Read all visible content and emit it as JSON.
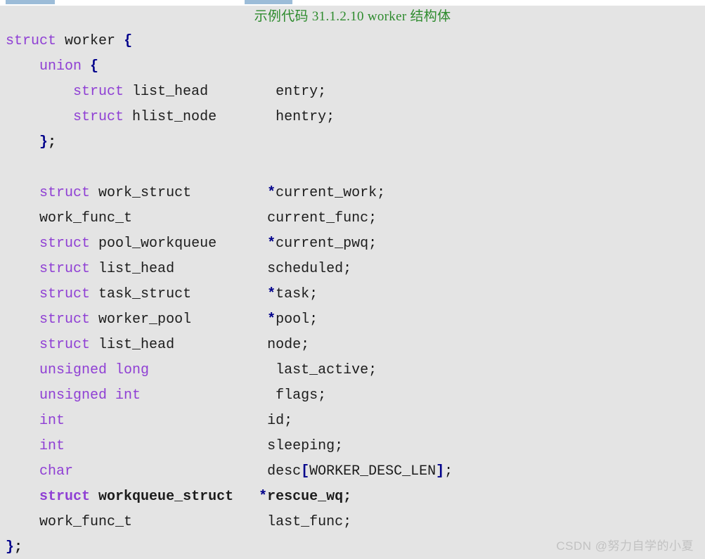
{
  "window": {
    "background_color": "#e4e4e4",
    "accent_color": "#9cbcd8"
  },
  "top_bars": {
    "left_bar_label": "",
    "right_bar_label": ""
  },
  "title": {
    "text": "示例代码 31.1.2.10 worker 结构体",
    "color": "#2e8b2e"
  },
  "watermark": {
    "text": "CSDN @努力自学的小夏",
    "color": "#c2c2c2"
  },
  "code": {
    "language": "c",
    "colors": {
      "keyword": "#8f3fd4",
      "identifier": "#1c1c1c",
      "punctuation": "#00008b",
      "background": "#e4e4e4"
    },
    "lines": [
      {
        "indent": 0,
        "bold": false,
        "tokens": [
          {
            "t": "struct",
            "c": "kw"
          },
          {
            "t": " ",
            "c": "id"
          },
          {
            "t": "worker",
            "c": "id"
          },
          {
            "t": " ",
            "c": "id"
          },
          {
            "t": "{",
            "c": "punct"
          }
        ]
      },
      {
        "indent": 1,
        "bold": false,
        "tokens": [
          {
            "t": "union",
            "c": "kw"
          },
          {
            "t": " ",
            "c": "id"
          },
          {
            "t": "{",
            "c": "punct"
          }
        ]
      },
      {
        "indent": 2,
        "bold": false,
        "tokens": [
          {
            "t": "struct",
            "c": "kw"
          },
          {
            "t": " ",
            "c": "id"
          },
          {
            "t": "list_head",
            "c": "id"
          },
          {
            "t": "        ",
            "c": "id"
          },
          {
            "t": "entry",
            "c": "var"
          },
          {
            "t": ";",
            "c": "semi"
          }
        ]
      },
      {
        "indent": 2,
        "bold": false,
        "tokens": [
          {
            "t": "struct",
            "c": "kw"
          },
          {
            "t": " ",
            "c": "id"
          },
          {
            "t": "hlist_node",
            "c": "id"
          },
          {
            "t": "       ",
            "c": "id"
          },
          {
            "t": "hentry",
            "c": "var"
          },
          {
            "t": ";",
            "c": "semi"
          }
        ]
      },
      {
        "indent": 1,
        "bold": true,
        "tokens": [
          {
            "t": "}",
            "c": "punct"
          },
          {
            "t": ";",
            "c": "semi"
          }
        ]
      },
      {
        "indent": 0,
        "bold": false,
        "blank": true,
        "tokens": []
      },
      {
        "indent": 1,
        "bold": false,
        "tokens": [
          {
            "t": "struct",
            "c": "kw"
          },
          {
            "t": " ",
            "c": "id"
          },
          {
            "t": "work_struct",
            "c": "id"
          },
          {
            "t": "         ",
            "c": "id"
          },
          {
            "t": "*",
            "c": "star"
          },
          {
            "t": "current_work",
            "c": "var"
          },
          {
            "t": ";",
            "c": "semi"
          }
        ]
      },
      {
        "indent": 1,
        "bold": false,
        "tokens": [
          {
            "t": "work_func_t",
            "c": "id"
          },
          {
            "t": "                ",
            "c": "id"
          },
          {
            "t": "current_func",
            "c": "var"
          },
          {
            "t": ";",
            "c": "semi"
          }
        ]
      },
      {
        "indent": 1,
        "bold": false,
        "tokens": [
          {
            "t": "struct",
            "c": "kw"
          },
          {
            "t": " ",
            "c": "id"
          },
          {
            "t": "pool_workqueue",
            "c": "id"
          },
          {
            "t": "      ",
            "c": "id"
          },
          {
            "t": "*",
            "c": "star"
          },
          {
            "t": "current_pwq",
            "c": "var"
          },
          {
            "t": ";",
            "c": "semi"
          }
        ]
      },
      {
        "indent": 1,
        "bold": false,
        "tokens": [
          {
            "t": "struct",
            "c": "kw"
          },
          {
            "t": " ",
            "c": "id"
          },
          {
            "t": "list_head",
            "c": "id"
          },
          {
            "t": "           ",
            "c": "id"
          },
          {
            "t": "scheduled",
            "c": "var"
          },
          {
            "t": ";",
            "c": "semi"
          }
        ]
      },
      {
        "indent": 1,
        "bold": false,
        "tokens": [
          {
            "t": "struct",
            "c": "kw"
          },
          {
            "t": " ",
            "c": "id"
          },
          {
            "t": "task_struct",
            "c": "id"
          },
          {
            "t": "         ",
            "c": "id"
          },
          {
            "t": "*",
            "c": "star"
          },
          {
            "t": "task",
            "c": "var"
          },
          {
            "t": ";",
            "c": "semi"
          }
        ]
      },
      {
        "indent": 1,
        "bold": false,
        "tokens": [
          {
            "t": "struct",
            "c": "kw"
          },
          {
            "t": " ",
            "c": "id"
          },
          {
            "t": "worker_pool",
            "c": "id"
          },
          {
            "t": "         ",
            "c": "id"
          },
          {
            "t": "*",
            "c": "star"
          },
          {
            "t": "pool",
            "c": "var"
          },
          {
            "t": ";",
            "c": "semi"
          }
        ]
      },
      {
        "indent": 1,
        "bold": false,
        "tokens": [
          {
            "t": "struct",
            "c": "kw"
          },
          {
            "t": " ",
            "c": "id"
          },
          {
            "t": "list_head",
            "c": "id"
          },
          {
            "t": "           ",
            "c": "id"
          },
          {
            "t": "node",
            "c": "var"
          },
          {
            "t": ";",
            "c": "semi"
          }
        ]
      },
      {
        "indent": 1,
        "bold": false,
        "tokens": [
          {
            "t": "unsigned",
            "c": "kw"
          },
          {
            "t": " ",
            "c": "id"
          },
          {
            "t": "long",
            "c": "kw"
          },
          {
            "t": "               ",
            "c": "id"
          },
          {
            "t": "last_active",
            "c": "var"
          },
          {
            "t": ";",
            "c": "semi"
          }
        ]
      },
      {
        "indent": 1,
        "bold": false,
        "tokens": [
          {
            "t": "unsigned",
            "c": "kw"
          },
          {
            "t": " ",
            "c": "id"
          },
          {
            "t": "int",
            "c": "kw"
          },
          {
            "t": "                ",
            "c": "id"
          },
          {
            "t": "flags",
            "c": "var"
          },
          {
            "t": ";",
            "c": "semi"
          }
        ]
      },
      {
        "indent": 1,
        "bold": false,
        "tokens": [
          {
            "t": "int",
            "c": "kw"
          },
          {
            "t": "                        ",
            "c": "id"
          },
          {
            "t": "id",
            "c": "var"
          },
          {
            "t": ";",
            "c": "semi"
          }
        ]
      },
      {
        "indent": 1,
        "bold": false,
        "tokens": [
          {
            "t": "int",
            "c": "kw"
          },
          {
            "t": "                        ",
            "c": "id"
          },
          {
            "t": "sleeping",
            "c": "var"
          },
          {
            "t": ";",
            "c": "semi"
          }
        ]
      },
      {
        "indent": 1,
        "bold": false,
        "tokens": [
          {
            "t": "char",
            "c": "kw"
          },
          {
            "t": "                       ",
            "c": "id"
          },
          {
            "t": "desc",
            "c": "var"
          },
          {
            "t": "[",
            "c": "punct"
          },
          {
            "t": "WORKER_DESC_LEN",
            "c": "var"
          },
          {
            "t": "]",
            "c": "punct"
          },
          {
            "t": ";",
            "c": "semi"
          }
        ]
      },
      {
        "indent": 1,
        "bold": true,
        "tokens": [
          {
            "t": "struct",
            "c": "kw"
          },
          {
            "t": " ",
            "c": "id"
          },
          {
            "t": "workqueue_struct",
            "c": "id"
          },
          {
            "t": "   ",
            "c": "id"
          },
          {
            "t": "*",
            "c": "star"
          },
          {
            "t": "rescue_wq",
            "c": "var"
          },
          {
            "t": ";",
            "c": "semi"
          }
        ]
      },
      {
        "indent": 1,
        "bold": false,
        "tokens": [
          {
            "t": "work_func_t",
            "c": "id"
          },
          {
            "t": "                ",
            "c": "id"
          },
          {
            "t": "last_func",
            "c": "var"
          },
          {
            "t": ";",
            "c": "semi"
          }
        ]
      },
      {
        "indent": 0,
        "bold": true,
        "tokens": [
          {
            "t": "}",
            "c": "punct"
          },
          {
            "t": ";",
            "c": "semi"
          }
        ]
      }
    ]
  }
}
